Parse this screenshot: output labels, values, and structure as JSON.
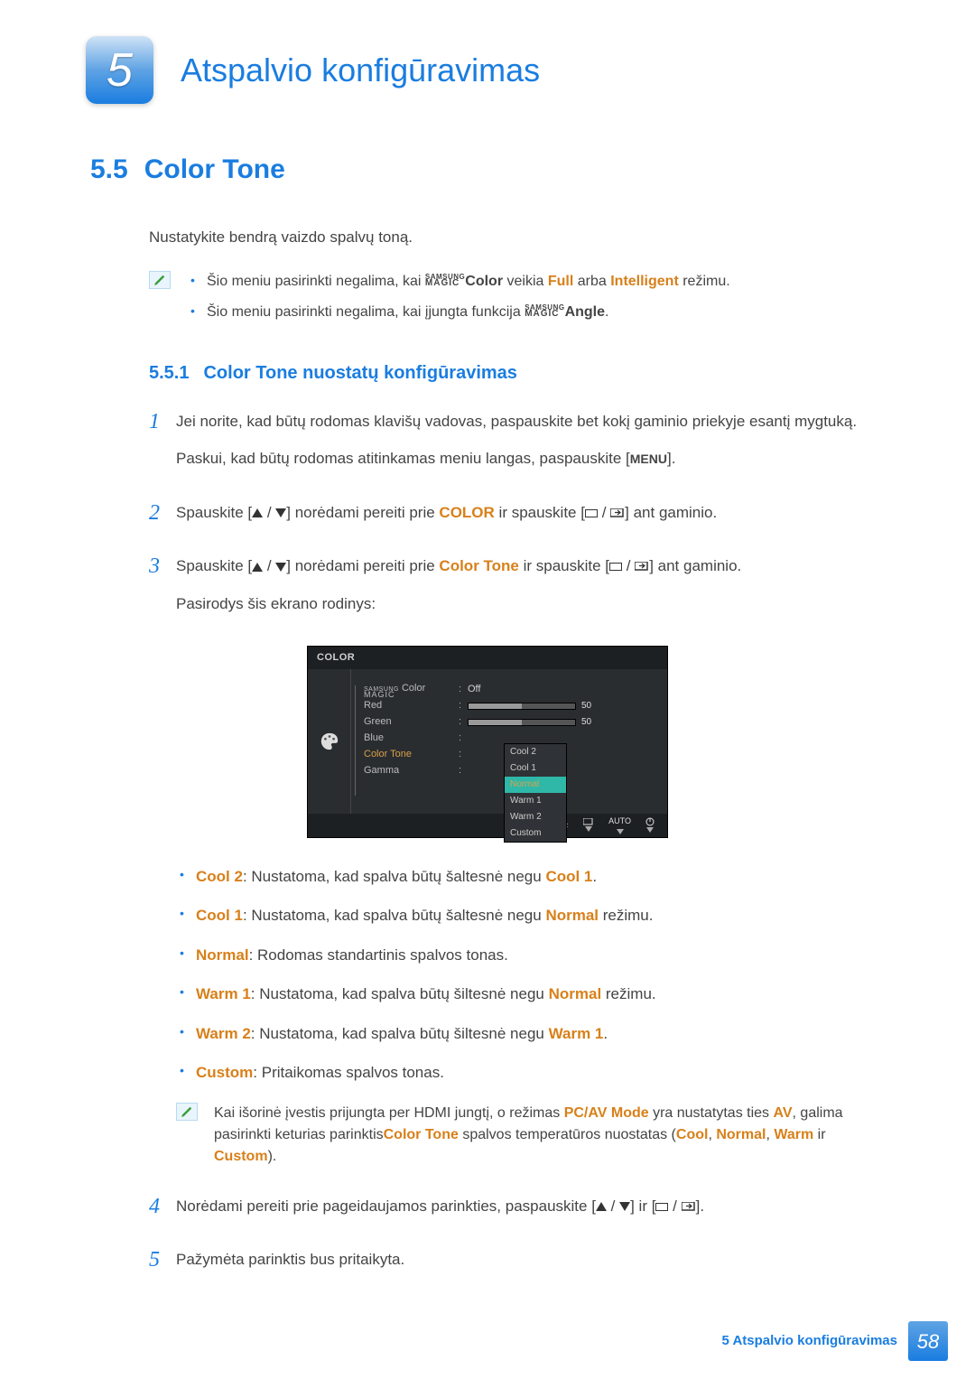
{
  "header": {
    "chapter_number": "5",
    "chapter_title": "Atspalvio konfigūravimas"
  },
  "section": {
    "number": "5.5",
    "title": "Color Tone",
    "intro": "Nustatykite bendrą vaizdo spalvų toną."
  },
  "note1": {
    "item1_pre": "Šio meniu pasirinkti negalima, kai ",
    "samsung": "SAMSUNG",
    "magic": "MAGIC",
    "color_word": "Color",
    "mid": " veikia ",
    "full": "Full",
    "or": " arba ",
    "intelligent": "Intelligent",
    "post": " režimu.",
    "item2_pre": "Šio meniu pasirinkti negalima, kai įjungta funkcija ",
    "angle_word": "Angle",
    "period": "."
  },
  "subsection": {
    "number": "5.5.1",
    "title": "Color Tone nuostatų konfigūravimas"
  },
  "steps": {
    "s1": {
      "num": "1",
      "p1": "Jei norite, kad būtų rodomas klavišų vadovas, paspauskite bet kokį gaminio priekyje esantį mygtuką.",
      "p2_pre": "Paskui, kad būtų rodomas atitinkamas meniu langas, paspauskite [",
      "menu": "MENU",
      "p2_post": "]."
    },
    "s2": {
      "num": "2",
      "pre": "Spauskite [",
      "mid1": "] norėdami pereiti prie ",
      "color": "COLOR",
      "mid2": " ir spauskite [",
      "post": "] ant gaminio."
    },
    "s3": {
      "num": "3",
      "pre": "Spauskite [",
      "mid1": "] norėdami pereiti prie ",
      "colortone": "Color Tone",
      "mid2": " ir spauskite [",
      "post": "] ant gaminio.",
      "p2": "Pasirodys šis ekrano rodinys:"
    },
    "s4": {
      "num": "4",
      "pre": "Norėdami pereiti prie pageidaujamos parinkties, paspauskite [",
      "mid": "] ir [",
      "post": "]."
    },
    "s5": {
      "num": "5",
      "text": "Pažymėta parinktis bus pritaikyta."
    }
  },
  "osd": {
    "title": "COLOR",
    "labels": {
      "magic_color": " Color",
      "red": "Red",
      "green": "Green",
      "blue": "Blue",
      "colortone": "Color Tone",
      "gamma": "Gamma"
    },
    "values": {
      "off": "Off",
      "fifty": "50"
    },
    "dropdown": [
      "Cool 2",
      "Cool 1",
      "Normal",
      "Warm 1",
      "Warm 2",
      "Custom"
    ],
    "footer_auto": "AUTO"
  },
  "tones": {
    "cool2": {
      "label": "Cool 2",
      "mid": ": Nustatoma, kad spalva būtų šaltesnė negu ",
      "ref": "Cool 1",
      "post": "."
    },
    "cool1": {
      "label": "Cool 1",
      "mid": ": Nustatoma, kad spalva būtų šaltesnė negu ",
      "ref": "Normal",
      "post": " režimu."
    },
    "normal": {
      "label": "Normal",
      "mid": ": Rodomas standartinis spalvos tonas."
    },
    "warm1": {
      "label": "Warm 1",
      "mid": ": Nustatoma, kad spalva būtų šiltesnė negu ",
      "ref": "Normal",
      "post": " režimu."
    },
    "warm2": {
      "label": "Warm 2",
      "mid": ": Nustatoma, kad spalva būtų šiltesnė negu ",
      "ref": "Warm 1",
      "post": "."
    },
    "custom": {
      "label": "Custom",
      "mid": ": Pritaikomas spalvos tonas."
    }
  },
  "note2": {
    "pre": "Kai išorinė įvestis prijungta per HDMI jungtį, o režimas ",
    "pcav": "PC/AV Mode",
    "mid1": " yra nustatytas ties ",
    "av": "AV",
    "mid2": ", galima pasirinkti keturias parinktis",
    "ct": "Color Tone",
    "mid3": " spalvos temperatūros nuostatas (",
    "cool": "Cool",
    "comma1": ", ",
    "normal": "Normal",
    "comma2": ", ",
    "warm": "Warm",
    "and": " ir ",
    "custom": "Custom",
    "post": ")."
  },
  "footer": {
    "text": "5 Atspalvio konfigūravimas",
    "page": "58"
  }
}
